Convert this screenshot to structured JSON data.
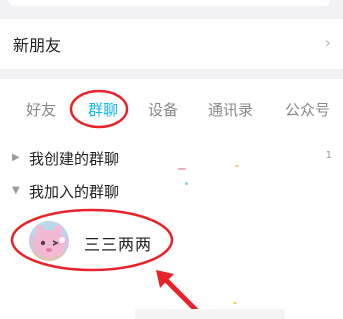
{
  "new_friend": {
    "label": "新朋友",
    "chevron": "›"
  },
  "tabs": [
    {
      "label": "好友"
    },
    {
      "label": "群聊"
    },
    {
      "label": "设备"
    },
    {
      "label": "通讯录"
    },
    {
      "label": "公众号"
    }
  ],
  "active_tab": "群聊",
  "group_sections": {
    "created": {
      "label": "我创建的群聊",
      "arrow": "▶",
      "count": "1"
    },
    "joined": {
      "label": "我加入的群聊",
      "arrow": "▼"
    }
  },
  "joined_chats": [
    {
      "name": "三三两两",
      "avatar_icon": "pink-cartoon-avatar-icon"
    }
  ],
  "colors": {
    "accent": "#12b7f5",
    "annotation_red": "#e8232a",
    "section_background": "#f2f2f6"
  }
}
